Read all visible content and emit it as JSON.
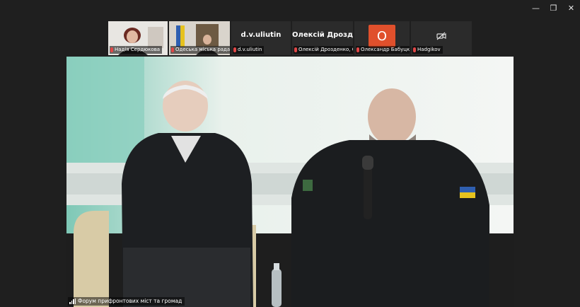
{
  "window_controls": {
    "minimize": "—",
    "restore": "❐",
    "close": "✕"
  },
  "participants": [
    {
      "name": "Надія Сердюкова",
      "type": "video"
    },
    {
      "name": "Одеська міська рада",
      "type": "video"
    },
    {
      "display": "d.v.uliutin",
      "name": "d.v.uliutin",
      "type": "name"
    },
    {
      "display": "Олексій Дрозд...",
      "name": "Олексій Дрозденко, С...",
      "type": "name"
    },
    {
      "avatar": "O",
      "name": "Олександр Бабуцкий",
      "type": "avatar"
    },
    {
      "name": "Hadgikov",
      "type": "camera-off",
      "icon": "camera-off-icon"
    }
  ],
  "main": {
    "caption": "Форум прифронтових міст та громад"
  }
}
